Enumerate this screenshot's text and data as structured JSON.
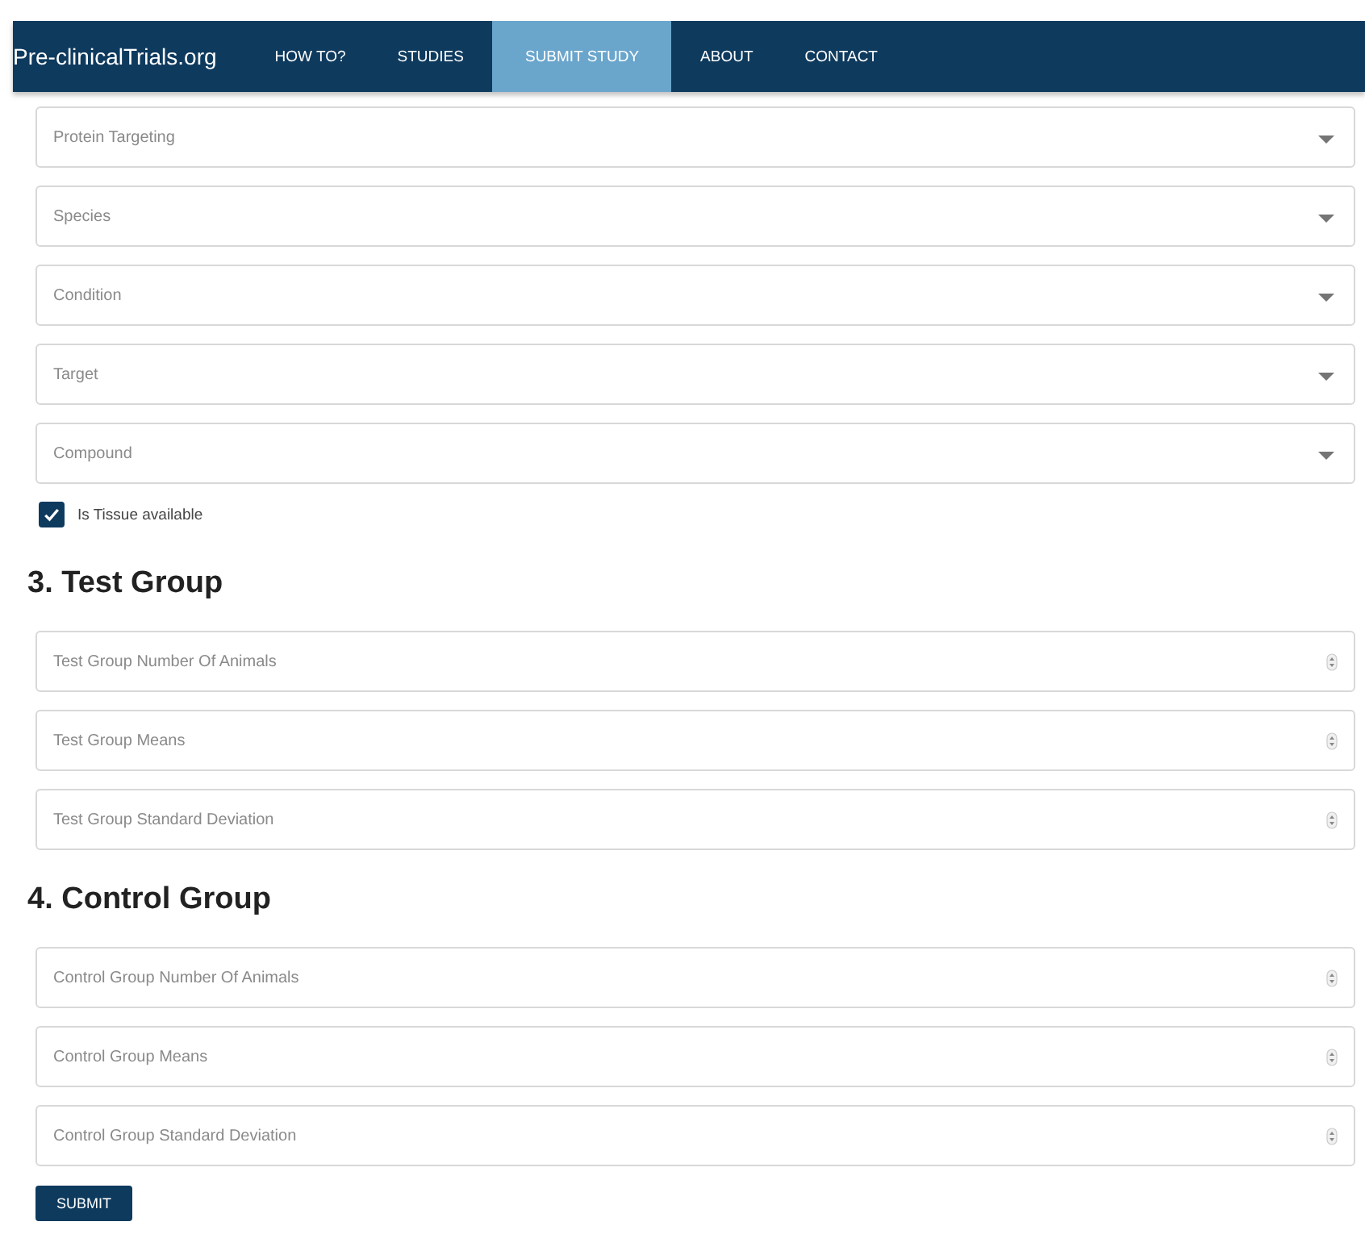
{
  "nav": {
    "brand": "Pre-clinicalTrials.org",
    "items": [
      {
        "label": "HOW TO?",
        "selected": false
      },
      {
        "label": "STUDIES",
        "selected": false
      },
      {
        "label": "SUBMIT STUDY",
        "selected": true
      },
      {
        "label": "ABOUT",
        "selected": false
      },
      {
        "label": "CONTACT",
        "selected": false
      }
    ]
  },
  "selects": [
    {
      "placeholder": "Protein Targeting"
    },
    {
      "placeholder": "Species"
    },
    {
      "placeholder": "Condition"
    },
    {
      "placeholder": "Target"
    },
    {
      "placeholder": "Compound"
    }
  ],
  "tissue_checkbox": {
    "label": "Is Tissue available",
    "checked": true
  },
  "sections": [
    {
      "heading": "3. Test Group",
      "fields": [
        {
          "placeholder": "Test Group Number Of Animals"
        },
        {
          "placeholder": "Test Group Means"
        },
        {
          "placeholder": "Test Group Standard Deviation"
        }
      ]
    },
    {
      "heading": "4. Control Group",
      "fields": [
        {
          "placeholder": "Control Group Number Of Animals"
        },
        {
          "placeholder": "Control Group Means"
        },
        {
          "placeholder": "Control Group Standard Deviation"
        }
      ]
    }
  ],
  "submit_button": "SUBMIT"
}
